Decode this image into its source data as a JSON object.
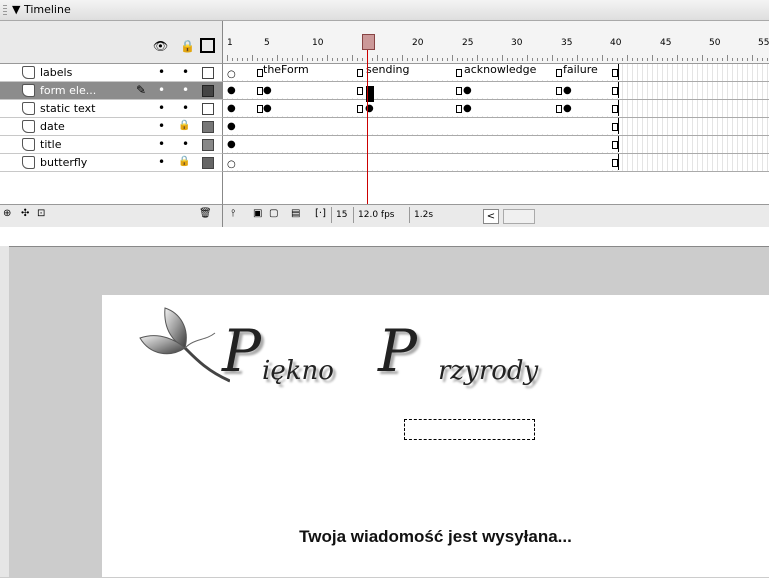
{
  "panel": {
    "title": "▼ Timeline"
  },
  "header_icons": {
    "eye": "eye-icon",
    "lock": "lock-icon",
    "outline": "outline-icon"
  },
  "ruler": {
    "numbers": [
      "1",
      "5",
      "10",
      "15",
      "20",
      "25",
      "30",
      "35",
      "40",
      "45",
      "50",
      "55"
    ]
  },
  "layers": [
    {
      "name": "labels",
      "visible": "•",
      "lock": "•"
    },
    {
      "name": "form ele...",
      "visible": "•",
      "lock": "•",
      "selected": true,
      "pencil": "✎"
    },
    {
      "name": "static text",
      "visible": "•",
      "lock": "•"
    },
    {
      "name": "date",
      "visible": "•",
      "lock": "🔒"
    },
    {
      "name": "title",
      "visible": "•",
      "lock": "•"
    },
    {
      "name": "butterfly",
      "visible": "•",
      "lock": "🔒"
    }
  ],
  "frame_labels": [
    "theForm",
    "sending",
    "acknowledge",
    "failure"
  ],
  "bottom_bar": {
    "current_frame": "15",
    "fps": "12.0 fps",
    "elapsed": "1.2s",
    "scroll_left": "<"
  },
  "stage": {
    "title_word1_initial": "P",
    "title_word1_rest": "iękno",
    "title_word2_initial": "P",
    "title_word2_rest": "rzyrody",
    "message": "Twoja wiadomość jest wysyłana..."
  }
}
